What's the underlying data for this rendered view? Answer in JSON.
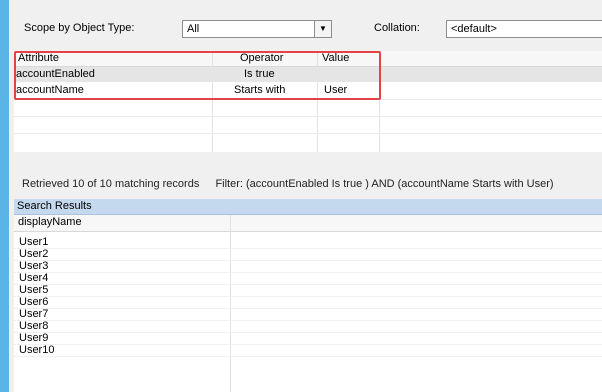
{
  "toolbar": {
    "scope_label": "Scope by Object Type:",
    "scope_value": "All",
    "collation_label": "Collation:",
    "collation_value": "<default>"
  },
  "filter_grid": {
    "columns": [
      "Attribute",
      "Operator",
      "Value"
    ],
    "rows": [
      {
        "attribute": "accountEnabled",
        "operator": "Is true",
        "value": ""
      },
      {
        "attribute": "accountName",
        "operator": "Starts with",
        "value": "User"
      }
    ]
  },
  "status": {
    "retrieved": "Retrieved 10 of 10 matching records",
    "filter": "Filter: (accountEnabled Is true ) AND (accountName Starts with User)"
  },
  "search_results": {
    "title": "Search Results",
    "column": "displayName",
    "rows": [
      "User1",
      "User2",
      "User3",
      "User4",
      "User5",
      "User6",
      "User7",
      "User8",
      "User9",
      "User10"
    ]
  },
  "colors": {
    "left_accent": "#5ab4e6",
    "highlight_border": "#e2434b",
    "results_header": "#c4d9ee"
  }
}
